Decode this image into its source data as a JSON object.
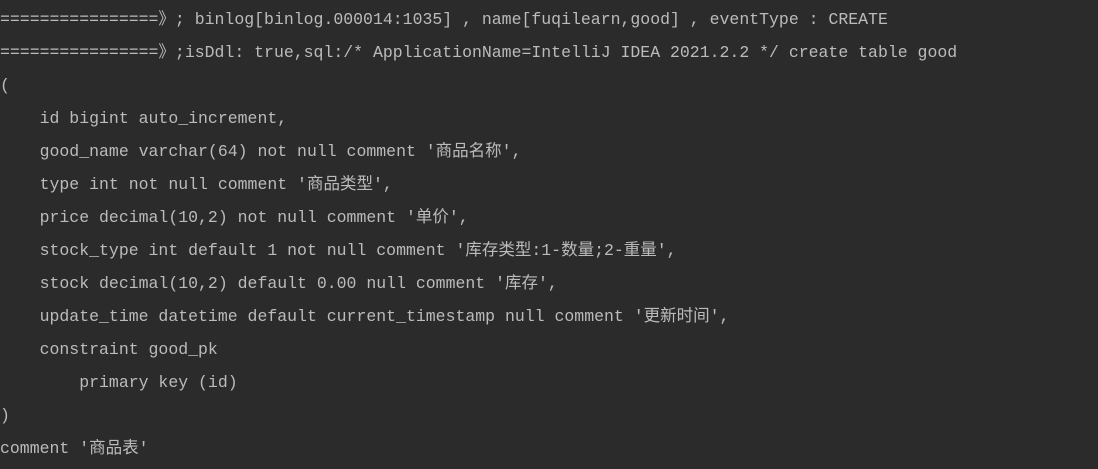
{
  "console": {
    "lines": [
      "================》; binlog[binlog.000014:1035] , name[fuqilearn,good] , eventType : CREATE",
      "================》;isDdl: true,sql:/* ApplicationName=IntelliJ IDEA 2021.2.2 */ create table good",
      "(",
      "    id bigint auto_increment,",
      "    good_name varchar(64) not null comment '商品名称',",
      "    type int not null comment '商品类型',",
      "    price decimal(10,2) not null comment '单价',",
      "    stock_type int default 1 not null comment '库存类型:1-数量;2-重量',",
      "    stock decimal(10,2) default 0.00 null comment '库存',",
      "    update_time datetime default current_timestamp null comment '更新时间',",
      "    constraint good_pk",
      "        primary key (id)",
      ")",
      "comment '商品表'"
    ]
  }
}
